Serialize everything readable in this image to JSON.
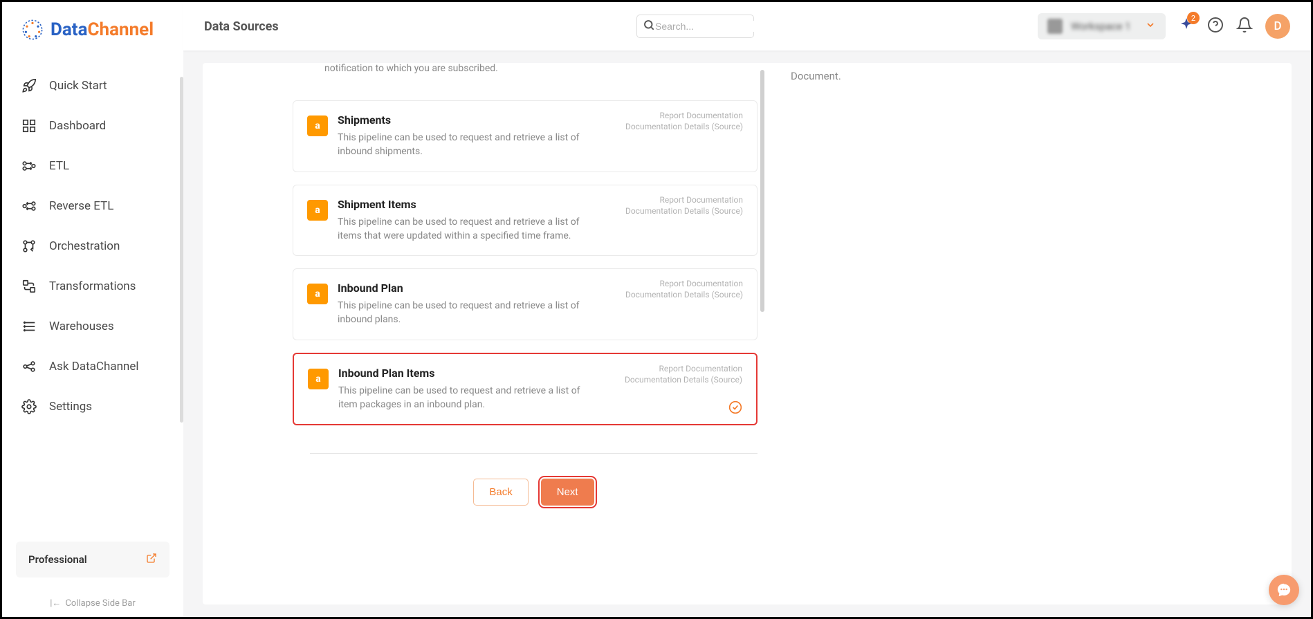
{
  "logo": {
    "text_primary": "Data",
    "text_secondary": "Channel"
  },
  "sidebar": {
    "items": [
      {
        "label": "Quick Start"
      },
      {
        "label": "Dashboard"
      },
      {
        "label": "ETL"
      },
      {
        "label": "Reverse ETL"
      },
      {
        "label": "Orchestration"
      },
      {
        "label": "Transformations"
      },
      {
        "label": "Warehouses"
      },
      {
        "label": "Ask DataChannel"
      },
      {
        "label": "Settings"
      }
    ],
    "plan": "Professional",
    "collapse": "Collapse Side Bar"
  },
  "header": {
    "title": "Data Sources",
    "search_placeholder": "Search...",
    "workspace": "Workspace 1",
    "notif_count": "2",
    "avatar_initial": "D"
  },
  "main": {
    "top_desc": "notification to which you are subscribed.",
    "info_panel": "Document.",
    "pipelines": [
      {
        "title": "Shipments",
        "desc": "This pipeline can be used to request and retrieve a list of inbound shipments.",
        "link1": "Report Documentation",
        "link2": "Documentation Details (Source)"
      },
      {
        "title": "Shipment Items",
        "desc": "This pipeline can be used to request and retrieve a list of items that were updated within a specified time frame.",
        "link1": "Report Documentation",
        "link2": "Documentation Details (Source)"
      },
      {
        "title": "Inbound Plan",
        "desc": "This pipeline can be used to request and retrieve a list of inbound plans.",
        "link1": "Report Documentation",
        "link2": "Documentation Details (Source)"
      },
      {
        "title": "Inbound Plan Items",
        "desc": "This pipeline can be used to request and retrieve a list of item packages in an inbound plan.",
        "link1": "Report Documentation",
        "link2": "Documentation Details (Source)"
      }
    ],
    "back_button": "Back",
    "next_button": "Next"
  }
}
